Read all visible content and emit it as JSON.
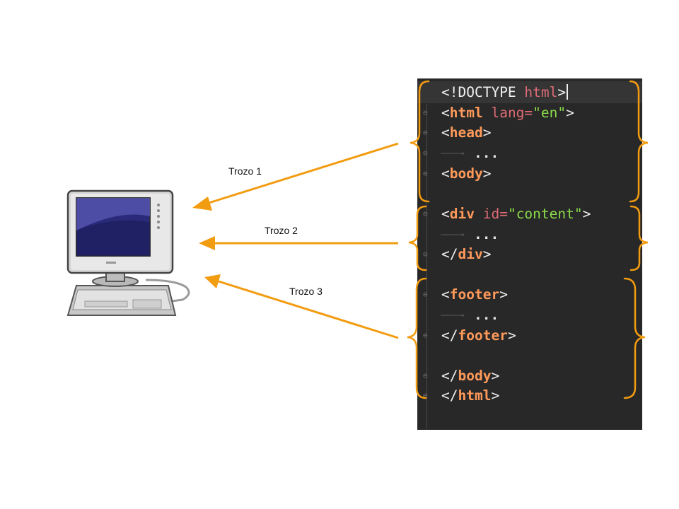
{
  "colors": {
    "arrow": "#f29c11",
    "brace": "#f29c11",
    "editor_bg": "#282828",
    "tag": "#ff9a5a",
    "attribute": "#e06c75",
    "string": "#8bdc4a"
  },
  "icons": {
    "computer": "desktop-computer-icon",
    "fold_open": "fold-marker-icon",
    "fold_close": "fold-end-icon"
  },
  "arrows": [
    {
      "label": "Trozo 1"
    },
    {
      "label": "Trozo 2"
    },
    {
      "label": "Trozo 3"
    }
  ],
  "code": {
    "doctype": {
      "open": "<!DOCTYPE ",
      "keyword": "html",
      "close": ">"
    },
    "html_open": {
      "lt": "<",
      "tag": "html",
      "attr": " lang=",
      "value": "\"en\"",
      "gt": ">"
    },
    "head_open": {
      "lt": "<",
      "tag": "head",
      "gt": ">"
    },
    "ellipsis": "...",
    "body_open": {
      "lt": "<",
      "tag": "body",
      "gt": ">"
    },
    "div_open": {
      "lt": "<",
      "tag": "div",
      "attr": " id=",
      "value": "\"content\"",
      "gt": ">"
    },
    "div_close": {
      "lt": "</",
      "tag": "div",
      "gt": ">"
    },
    "footer_open": {
      "lt": "<",
      "tag": "footer",
      "gt": ">"
    },
    "footer_close": {
      "lt": "</",
      "tag": "footer",
      "gt": ">"
    },
    "body_close": {
      "lt": "</",
      "tag": "body",
      "gt": ">"
    },
    "html_close": {
      "lt": "</",
      "tag": "html",
      "gt": ">"
    }
  }
}
